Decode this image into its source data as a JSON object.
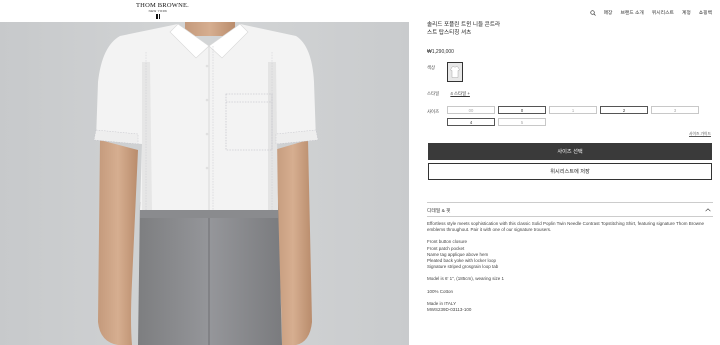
{
  "header": {
    "logo": {
      "name": "THOM BROWNE.",
      "sub": "NEW YORK"
    },
    "nav": [
      "매장",
      "브랜드 소개",
      "위시리스트",
      "계정",
      "쇼핑백"
    ]
  },
  "product": {
    "title": "솔리드 포플린 트윈 니들 콘트라\n스트 탑스티칭 셔츠",
    "price": "₩1,290,000",
    "color_label": "색상",
    "style_label": "스타일",
    "style_value": "4 스타일 +",
    "size_label": "사이즈",
    "sizes": [
      {
        "label": "00",
        "available": false
      },
      {
        "label": "0",
        "available": true
      },
      {
        "label": "1",
        "available": false
      },
      {
        "label": "2",
        "available": true
      },
      {
        "label": "3",
        "available": false
      },
      {
        "label": "4",
        "available": true
      },
      {
        "label": "5",
        "available": false
      }
    ],
    "size_guide": "사이즈 가이드",
    "select_size_button": "사이즈 선택",
    "wishlist_button": "위시리스트에 저장",
    "details_heading": "디테일 & 핏",
    "description": "Effortless style meets sophistication with this classic Solid Poplin Twin Needle Contrast Topstitching Shirt, featuring signature Thom Browne emblems throughout. Pair it with one of our signature trousers.",
    "features": [
      "Front button closure",
      "Front patch pocket",
      "Name tag applique above hem",
      "Pleated back yoke with locker loop",
      "Signature striped grosgrain loop tab"
    ],
    "model_info": "Model is 6' 1\", (185cm), wearing size 1",
    "material": "100% Cotton",
    "origin": "Made in ITALY",
    "sku": "MWS239D-03113-100"
  },
  "colors": {
    "primary_button": "#3a3a3a",
    "background_gray": "#cfd1d3",
    "shirt": "#f4f4f4",
    "trousers": "#8e8f91"
  }
}
